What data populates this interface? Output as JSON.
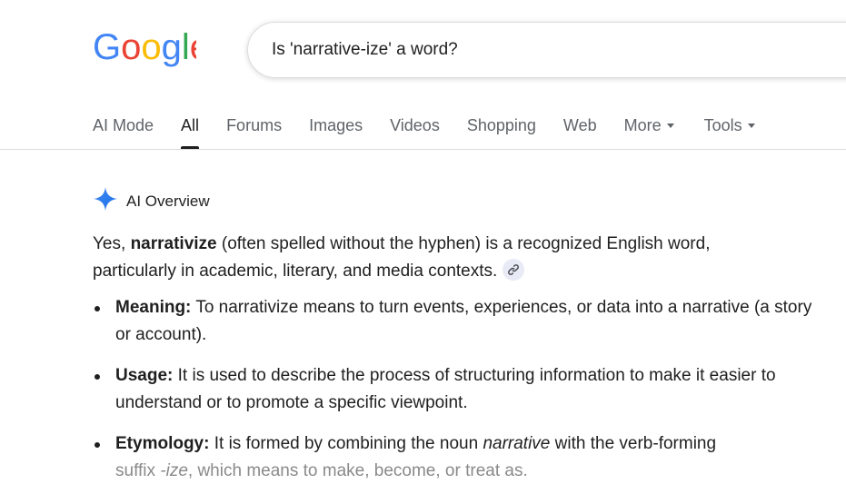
{
  "logo": {
    "text": "Google"
  },
  "search": {
    "query": "Is 'narrative-ize' a word?"
  },
  "tabs": [
    {
      "label": "AI Mode"
    },
    {
      "label": "All"
    },
    {
      "label": "Forums"
    },
    {
      "label": "Images"
    },
    {
      "label": "Videos"
    },
    {
      "label": "Shopping"
    },
    {
      "label": "Web"
    },
    {
      "label": "More"
    },
    {
      "label": "Tools"
    }
  ],
  "active_tab": "All",
  "ai_overview": {
    "label": "AI Overview",
    "intro": {
      "lead": "Yes, ",
      "term": "narrativize",
      "line1_rest": " (often spelled without the hyphen) is a recognized English word,",
      "line2": "particularly in academic, literary, and media contexts."
    },
    "bullets": [
      {
        "title": "Meaning:",
        "text": " To narrativize means to turn events, experiences, or data into a narrative (a story or account)."
      },
      {
        "title": "Usage:",
        "text": " It is used to describe the process of structuring information to make it easier to understand or to promote a specific viewpoint."
      },
      {
        "title": "Etymology:",
        "text_a": " It is formed by combining the noun ",
        "italic_a": "narrative",
        "text_b": " with the verb-forming",
        "faded_a": "suffix ",
        "italic_b": "-ize",
        "faded_b": ", which means to make, become, or treat as."
      }
    ]
  },
  "colors": {
    "google_blue": "#4285F4",
    "google_red": "#EA4335",
    "google_yellow": "#FBBC05",
    "google_green": "#34A853",
    "text": "#1f1f1f",
    "muted": "#5f6368"
  },
  "icons": {
    "ai": "sparkle-icon",
    "link": "link-icon",
    "caret": "caret-down-icon"
  }
}
